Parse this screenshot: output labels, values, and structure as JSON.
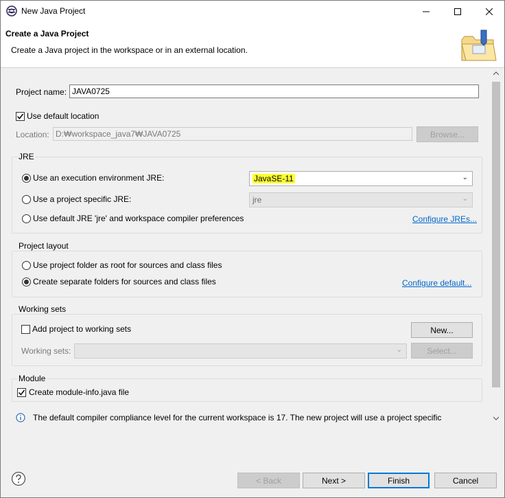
{
  "window": {
    "title": "New Java Project"
  },
  "header": {
    "title": "Create a Java Project",
    "description": "Create a Java project in the workspace or in an external location."
  },
  "project": {
    "name_label": "Project name:",
    "name_value": "JAVA0725",
    "use_default_location_label": "Use default location",
    "location_label": "Location:",
    "location_value": "D:₩workspace_java7₩JAVA0725",
    "browse_label": "Browse..."
  },
  "jre": {
    "group_title": "JRE",
    "exec_env_label": "Use an execution environment JRE:",
    "exec_env_value": "JavaSE-11",
    "project_specific_label": "Use a project specific JRE:",
    "project_specific_value": "jre",
    "default_jre_label": "Use default JRE 'jre' and workspace compiler preferences",
    "configure_link": "Configure JREs..."
  },
  "layout": {
    "group_title": "Project layout",
    "root_label": "Use project folder as root for sources and class files",
    "separate_label": "Create separate folders for sources and class files",
    "configure_link": "Configure default..."
  },
  "working_sets": {
    "group_title": "Working sets",
    "add_label": "Add project to working sets",
    "new_label": "New...",
    "sets_label": "Working sets:",
    "select_label": "Select..."
  },
  "module": {
    "group_title": "Module",
    "create_label": "Create module-info.java file"
  },
  "info": {
    "message": "The default compiler compliance level for the current workspace is 17. The new project will use a project specific"
  },
  "footer": {
    "back_label": "< Back",
    "next_label": "Next >",
    "finish_label": "Finish",
    "cancel_label": "Cancel"
  },
  "icons": {
    "app": "eclipse-icon",
    "header": "java-project-folder-icon",
    "help": "help-icon",
    "info": "info-icon"
  }
}
